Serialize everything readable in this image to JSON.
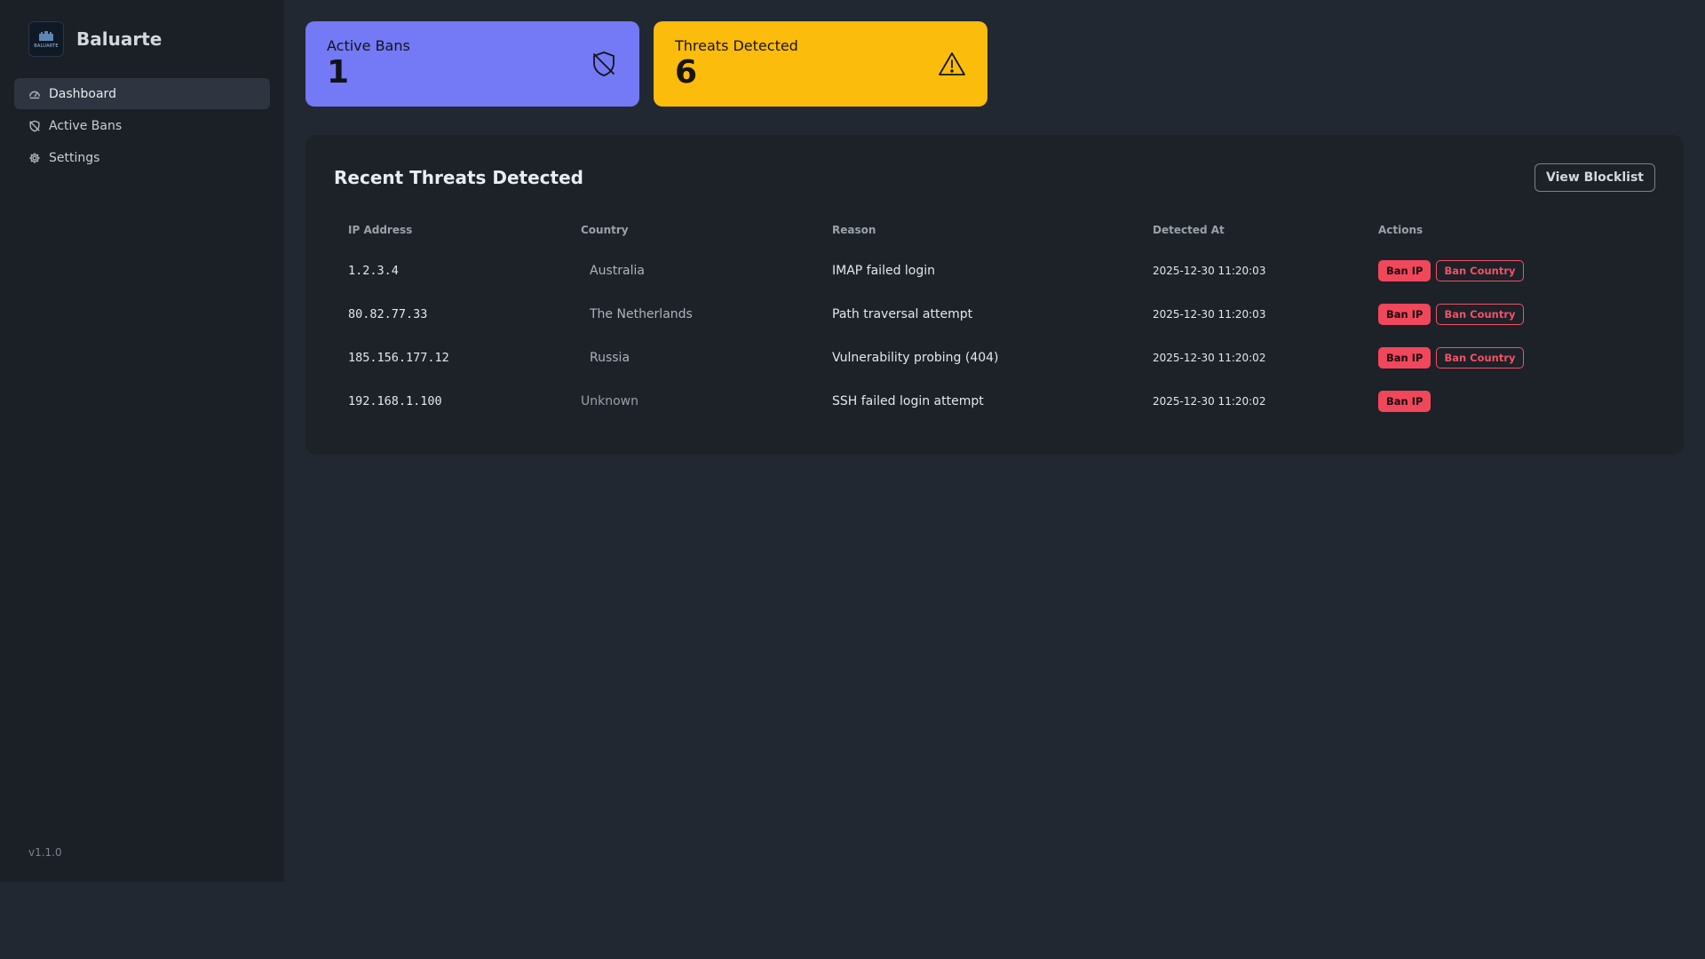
{
  "sidebar": {
    "brand": {
      "name": "Baluarte",
      "logo_text": "BALUARTE"
    },
    "items": [
      {
        "label": "Dashboard",
        "icon": "dashboard-icon",
        "active": true
      },
      {
        "label": "Active Bans",
        "icon": "shield-off-icon",
        "active": false
      },
      {
        "label": "Settings",
        "icon": "gear-icon",
        "active": false
      }
    ],
    "version": "v1.1.0"
  },
  "stats": {
    "active_bans": {
      "label": "Active Bans",
      "value": "1",
      "color": "#7479f6",
      "icon": "shield-off-icon"
    },
    "threats_detected": {
      "label": "Threats Detected",
      "value": "6",
      "color": "#fbbc0b",
      "icon": "warning-icon"
    }
  },
  "threats": {
    "title": "Recent Threats Detected",
    "view_button": "View Blocklist",
    "columns": [
      "IP Address",
      "Country",
      "Reason",
      "Detected At",
      "Actions"
    ],
    "rows": [
      {
        "ip": "1.2.3.4",
        "country": "Australia",
        "reason": "IMAP failed login",
        "detected_at": "2025-12-30 11:20:03",
        "ban_ip": "Ban IP",
        "ban_country": "Ban Country"
      },
      {
        "ip": "80.82.77.33",
        "country": "The Netherlands",
        "reason": "Path traversal attempt",
        "detected_at": "2025-12-30 11:20:03",
        "ban_ip": "Ban IP",
        "ban_country": "Ban Country"
      },
      {
        "ip": "185.156.177.12",
        "country": "Russia",
        "reason": "Vulnerability probing (404)",
        "detected_at": "2025-12-30 11:20:02",
        "ban_ip": "Ban IP",
        "ban_country": "Ban Country"
      },
      {
        "ip": "192.168.1.100",
        "country": "Unknown",
        "reason": "SSH failed login attempt",
        "detected_at": "2025-12-30 11:20:02",
        "ban_ip": "Ban IP",
        "ban_country": null
      }
    ]
  },
  "colors": {
    "danger": "#f0475b",
    "background": "#222831",
    "sidebar": "#1b1f26",
    "panel": "#1d2128"
  }
}
